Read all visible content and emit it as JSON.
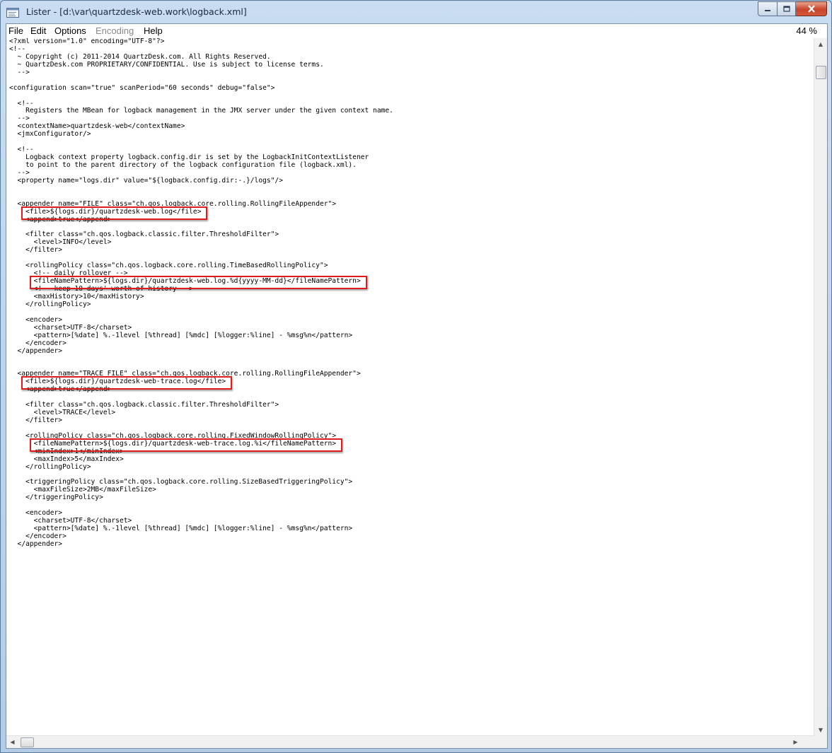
{
  "window": {
    "title": "Lister - [d:\\var\\quartzdesk-web.work\\logback.xml]"
  },
  "menu": {
    "items": [
      {
        "label": "File"
      },
      {
        "label": "Edit"
      },
      {
        "label": "Options"
      },
      {
        "label": "Encoding"
      },
      {
        "label": "Help"
      }
    ],
    "zoom": "44 %"
  },
  "lines": [
    "<?xml version=\"1.0\" encoding=\"UTF-8\"?>",
    "<!--",
    "  ~ Copyright (c) 2011-2014 QuartzDesk.com. All Rights Reserved.",
    "  ~ QuartzDesk.com PROPRIETARY/CONFIDENTIAL. Use is subject to license terms.",
    "  -->",
    "",
    "<configuration scan=\"true\" scanPeriod=\"60 seconds\" debug=\"false\">",
    "",
    "  <!--",
    "    Registers the MBean for logback management in the JMX server under the given context name.",
    "  -->",
    "  <contextName>quartzdesk-web</contextName>",
    "  <jmxConfigurator/>",
    "",
    "  <!--",
    "    Logback context property logback.config.dir is set by the LogbackInitContextListener",
    "    to point to the parent directory of the logback configuration file (logback.xml).",
    "  -->",
    "  <property name=\"logs.dir\" value=\"${logback.config.dir:-.}/logs\"/>",
    "",
    "",
    "  <appender name=\"FILE\" class=\"ch.qos.logback.core.rolling.RollingFileAppender\">",
    "    <file>${logs.dir}/quartzdesk-web.log</file>",
    "    <append>true</append>",
    "",
    "    <filter class=\"ch.qos.logback.classic.filter.ThresholdFilter\">",
    "      <level>INFO</level>",
    "    </filter>",
    "",
    "    <rollingPolicy class=\"ch.qos.logback.core.rolling.TimeBasedRollingPolicy\">",
    "      <!-- daily rollover -->",
    "      <fileNamePattern>${logs.dir}/quartzdesk-web.log.%d{yyyy-MM-dd}</fileNamePattern>",
    "      <!-- keep 10 days' worth of history -->",
    "      <maxHistory>10</maxHistory>",
    "    </rollingPolicy>",
    "",
    "    <encoder>",
    "      <charset>UTF-8</charset>",
    "      <pattern>[%date] %.-1level [%thread] [%mdc] [%logger:%line] - %msg%n</pattern>",
    "    </encoder>",
    "  </appender>",
    "",
    "",
    "  <appender name=\"TRACE_FILE\" class=\"ch.qos.logback.core.rolling.RollingFileAppender\">",
    "    <file>${logs.dir}/quartzdesk-web-trace.log</file>",
    "    <append>true</append>",
    "",
    "    <filter class=\"ch.qos.logback.classic.filter.ThresholdFilter\">",
    "      <level>TRACE</level>",
    "    </filter>",
    "",
    "    <rollingPolicy class=\"ch.qos.logback.core.rolling.FixedWindowRollingPolicy\">",
    "      <fileNamePattern>${logs.dir}/quartzdesk-web-trace.log.%i</fileNamePattern>",
    "      <minIndex>1</minIndex>",
    "      <maxIndex>5</maxIndex>",
    "    </rollingPolicy>",
    "",
    "    <triggeringPolicy class=\"ch.qos.logback.core.rolling.SizeBasedTriggeringPolicy\">",
    "      <maxFileSize>2MB</maxFileSize>",
    "    </triggeringPolicy>",
    "",
    "    <encoder>",
    "      <charset>UTF-8</charset>",
    "      <pattern>[%date] %.-1level [%thread] [%mdc] [%logger:%line] - %msg%n</pattern>",
    "    </encoder>",
    "  </appender>"
  ],
  "highlighted_lines": [
    22,
    31,
    44,
    52
  ],
  "colors": {
    "highlight_border": "#e01b1b",
    "close_button": "#c8442b",
    "title_bar": "#c9dcf1"
  }
}
